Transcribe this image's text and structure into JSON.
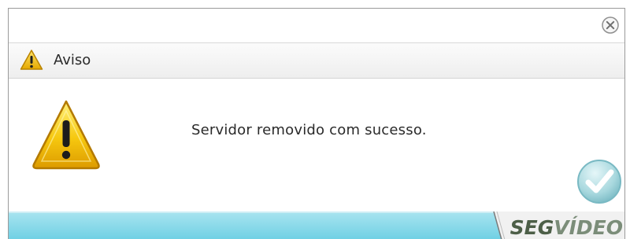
{
  "window": {
    "close_icon": "close-icon"
  },
  "header": {
    "icon": "warning-icon",
    "title": "Aviso"
  },
  "body": {
    "icon": "warning-icon",
    "message": "Servidor removido com sucesso.",
    "confirm_icon": "checkmark-icon"
  },
  "footer": {
    "logo_part1": "SEG",
    "logo_part2": "VÍDEO"
  },
  "colors": {
    "footer_accent": "#7fd6e8",
    "warning": "#f3c316",
    "confirm": "#8cc8cf"
  }
}
